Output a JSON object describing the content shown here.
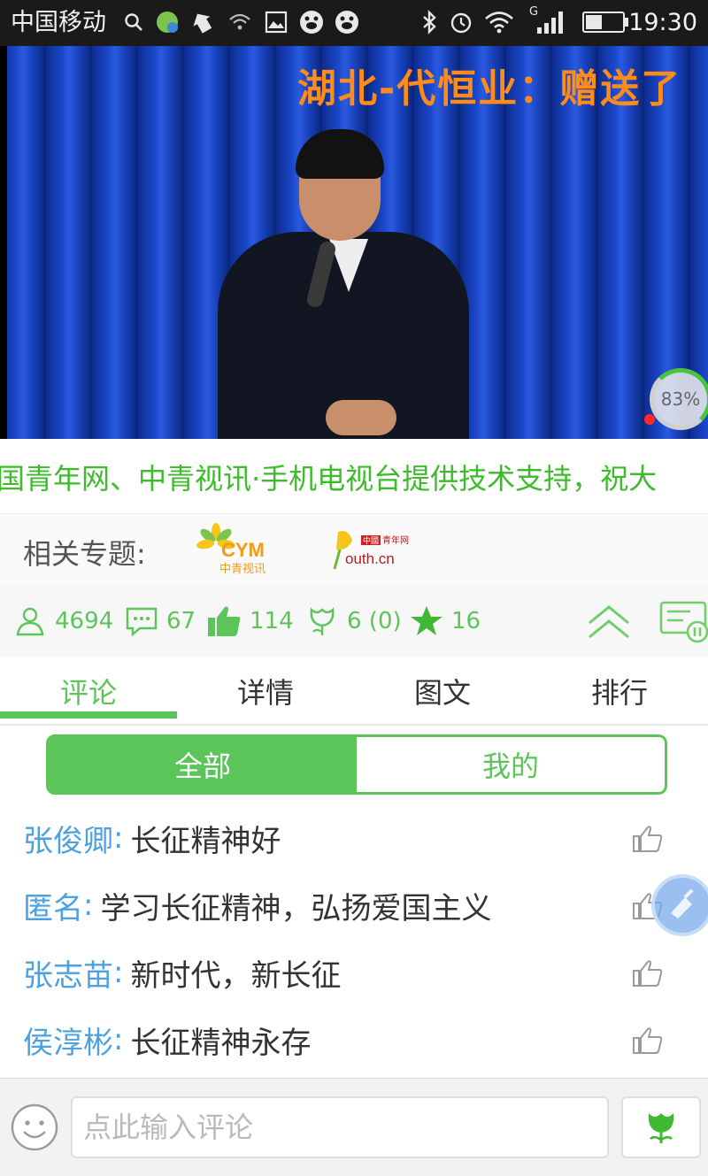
{
  "status_bar": {
    "carrier": "中国移动",
    "time": "19:30",
    "network_label": "G",
    "battery_level": 0.45,
    "icons": [
      "search-icon",
      "app-icon",
      "app-icon",
      "wifi-icon",
      "image-icon",
      "baidu-icon",
      "baidu-icon",
      "bluetooth-icon",
      "alarm-icon",
      "wifi-icon",
      "signal-icon",
      "battery-icon"
    ]
  },
  "video": {
    "danmu_text": "湖北-代恒业：赠送了",
    "buffer_progress": "83%"
  },
  "ticker": {
    "text": "国青年网、中青视讯·手机电视台提供技术支持，祝大"
  },
  "related": {
    "label": "相关专题:",
    "logos": [
      {
        "name": "CYM",
        "caption": "中青视讯"
      },
      {
        "name": "outh.cn",
        "caption": "中国青年网"
      }
    ]
  },
  "stats": {
    "viewers": "4694",
    "comments": "67",
    "likes": "114",
    "flowers": "6 (0)",
    "favorites": "16"
  },
  "tabs": [
    {
      "label": "评论",
      "active": true
    },
    {
      "label": "详情",
      "active": false
    },
    {
      "label": "图文",
      "active": false
    },
    {
      "label": "排行",
      "active": false
    }
  ],
  "filter": {
    "all_label": "全部",
    "mine_label": "我的",
    "selected": "全部"
  },
  "comments": [
    {
      "user": "张俊卿",
      "text": "长征精神好"
    },
    {
      "user": "匿名",
      "text": "学习长征精神，弘扬爱国主义"
    },
    {
      "user": "张志苗",
      "text": "新时代，新长征"
    },
    {
      "user": "侯淳彬",
      "text": "长征精神永存"
    }
  ],
  "input": {
    "placeholder": "点此输入评论"
  },
  "colors": {
    "accent": "#5cc55a",
    "username": "#4ea1e0",
    "danmu": "#ff8c1a"
  }
}
